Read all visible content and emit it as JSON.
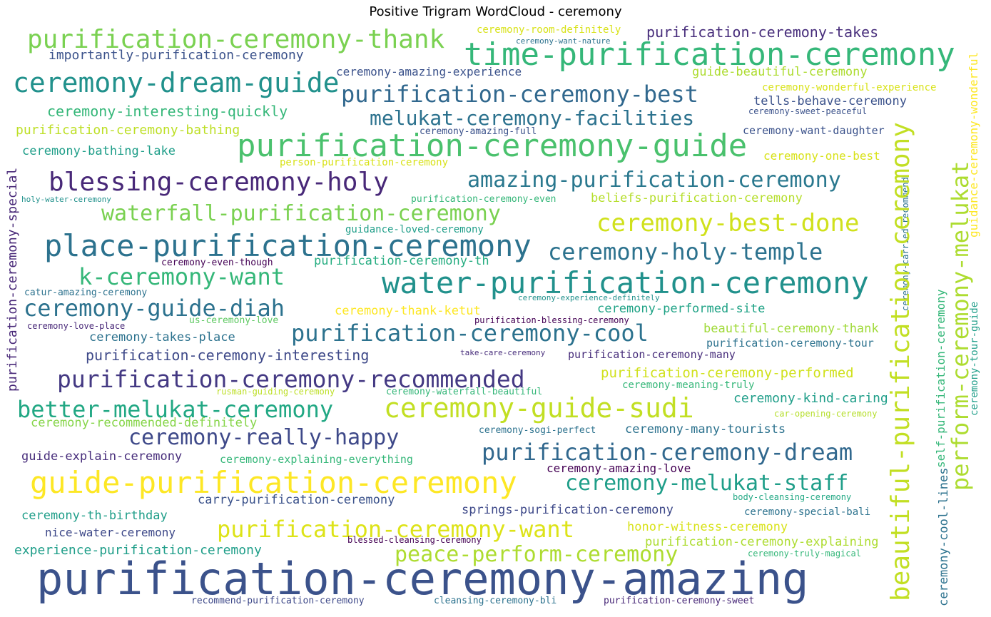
{
  "chart_data": {
    "type": "wordcloud",
    "title": "Positive Trigram WordCloud - ceremony",
    "words": [
      {
        "text": "purification-ceremony-thank",
        "color": "#7ad151"
      },
      {
        "text": "ceremony-room-definitely",
        "color": "#d8e219"
      },
      {
        "text": "ceremony-want-nature",
        "color": "#2c728e"
      },
      {
        "text": "purification-ceremony-takes",
        "color": "#472d7b"
      },
      {
        "text": "importantly-purification-ceremony",
        "color": "#3b528b"
      },
      {
        "text": "time-purification-ceremony",
        "color": "#35b779"
      },
      {
        "text": "ceremony-amazing-experience",
        "color": "#3b528b"
      },
      {
        "text": "guide-beautiful-ceremony",
        "color": "#addc30"
      },
      {
        "text": "ceremony-dream-guide",
        "color": "#21918c"
      },
      {
        "text": "ceremony-wonderful-experience",
        "color": "#d8e219"
      },
      {
        "text": "purification-ceremony-best",
        "color": "#31688e"
      },
      {
        "text": "tells-behave-ceremony",
        "color": "#3b528b"
      },
      {
        "text": "ceremony-interesting-quickly",
        "color": "#35b779"
      },
      {
        "text": "melukat-ceremony-facilities",
        "color": "#2c728e"
      },
      {
        "text": "ceremony-sweet-peaceful",
        "color": "#3b528b"
      },
      {
        "text": "purification-ceremony-bathing",
        "color": "#bddf26"
      },
      {
        "text": "ceremony-amazing-full",
        "color": "#3b528b"
      },
      {
        "text": "ceremony-want-daughter",
        "color": "#3b528b"
      },
      {
        "text": "ceremony-bathing-lake",
        "color": "#1f9e89"
      },
      {
        "text": "purification-ceremony-guide",
        "color": "#4ac16d"
      },
      {
        "text": "ceremony-one-best",
        "color": "#d8e219"
      },
      {
        "text": "person-purification-ceremony",
        "color": "#d8e219"
      },
      {
        "text": "blessing-ceremony-holy",
        "color": "#482878"
      },
      {
        "text": "amazing-purification-ceremony",
        "color": "#2a788e"
      },
      {
        "text": "holy-water-ceremony",
        "color": "#21918c"
      },
      {
        "text": "purification-ceremony-even",
        "color": "#35b779"
      },
      {
        "text": "beliefs-purification-ceremony",
        "color": "#b5de2b"
      },
      {
        "text": "waterfall-purification-ceremony",
        "color": "#7ad151"
      },
      {
        "text": "ceremony-best-done",
        "color": "#d0e11c"
      },
      {
        "text": "guidance-loved-ceremony",
        "color": "#1f9e89"
      },
      {
        "text": "place-purification-ceremony",
        "color": "#2c728e"
      },
      {
        "text": "ceremony-holy-temple",
        "color": "#2c728e"
      },
      {
        "text": "ceremony-even-though",
        "color": "#440154"
      },
      {
        "text": "purification-ceremony-th",
        "color": "#26ad81"
      },
      {
        "text": "k-ceremony-want",
        "color": "#35b779"
      },
      {
        "text": "water-purification-ceremony",
        "color": "#21918c"
      },
      {
        "text": "catur-amazing-ceremony",
        "color": "#2c728e"
      },
      {
        "text": "ceremony-experience-definitely",
        "color": "#21918c"
      },
      {
        "text": "ceremony-guide-diah",
        "color": "#2c728e"
      },
      {
        "text": "ceremony-thank-ketut",
        "color": "#fde725"
      },
      {
        "text": "ceremony-performed-site",
        "color": "#20a386"
      },
      {
        "text": "ceremony-love-place",
        "color": "#482878"
      },
      {
        "text": "us-ceremony-love",
        "color": "#5ec962"
      },
      {
        "text": "purification-blessing-ceremony",
        "color": "#440154"
      },
      {
        "text": "purification-ceremony-cool",
        "color": "#2c728e"
      },
      {
        "text": "beautiful-ceremony-thank",
        "color": "#a0da39"
      },
      {
        "text": "ceremony-takes-place",
        "color": "#2c728e"
      },
      {
        "text": "purification-ceremony-tour",
        "color": "#2c728e"
      },
      {
        "text": "purification-ceremony-interesting",
        "color": "#3e4989"
      },
      {
        "text": "take-care-ceremony",
        "color": "#472d7b"
      },
      {
        "text": "purification-ceremony-many",
        "color": "#472d7b"
      },
      {
        "text": "purification-ceremony-recommended",
        "color": "#443983"
      },
      {
        "text": "purification-ceremony-performed",
        "color": "#d0e11c"
      },
      {
        "text": "rusman-guiding-ceremony",
        "color": "#bddf26"
      },
      {
        "text": "ceremony-waterfall-beautiful",
        "color": "#35b779"
      },
      {
        "text": "ceremony-meaning-truly",
        "color": "#35b779"
      },
      {
        "text": "better-melukat-ceremony",
        "color": "#22a884"
      },
      {
        "text": "ceremony-guide-sudi",
        "color": "#c2df23"
      },
      {
        "text": "ceremony-kind-caring",
        "color": "#1f9e89"
      },
      {
        "text": "ceremony-recommended-definitely",
        "color": "#86d549"
      },
      {
        "text": "car-opening-ceremony",
        "color": "#b5de2b"
      },
      {
        "text": "ceremony-really-happy",
        "color": "#3e4989"
      },
      {
        "text": "ceremony-sogi-perfect",
        "color": "#2c728e"
      },
      {
        "text": "ceremony-many-tourists",
        "color": "#2c728e"
      },
      {
        "text": "guide-explain-ceremony",
        "color": "#472d7b"
      },
      {
        "text": "ceremony-explaining-everything",
        "color": "#35b779"
      },
      {
        "text": "purification-ceremony-dream",
        "color": "#31688e"
      },
      {
        "text": "ceremony-amazing-love",
        "color": "#440154"
      },
      {
        "text": "guide-purification-ceremony",
        "color": "#fde725"
      },
      {
        "text": "ceremony-melukat-staff",
        "color": "#1f9e89"
      },
      {
        "text": "carry-purification-ceremony",
        "color": "#3b528b"
      },
      {
        "text": "body-cleansing-ceremony",
        "color": "#22a884"
      },
      {
        "text": "springs-purification-ceremony",
        "color": "#3e4989"
      },
      {
        "text": "ceremony-special-bali",
        "color": "#2c728e"
      },
      {
        "text": "ceremony-th-birthday",
        "color": "#1f9e89"
      },
      {
        "text": "nice-water-ceremony",
        "color": "#3e4989"
      },
      {
        "text": "purification-ceremony-want",
        "color": "#dde318"
      },
      {
        "text": "honor-witness-ceremony",
        "color": "#d8e219"
      },
      {
        "text": "experience-purification-ceremony",
        "color": "#1f9e89"
      },
      {
        "text": "blessed-cleansing-ceremony",
        "color": "#440154"
      },
      {
        "text": "peace-perform-ceremony",
        "color": "#addc30"
      },
      {
        "text": "purification-ceremony-explaining",
        "color": "#addc30"
      },
      {
        "text": "ceremony-truly-magical",
        "color": "#35b779"
      },
      {
        "text": "purification-ceremony-amazing",
        "color": "#3b528b"
      },
      {
        "text": "recommend-purification-ceremony",
        "color": "#3e4989"
      },
      {
        "text": "cleansing-ceremony-bli",
        "color": "#2c728e"
      },
      {
        "text": "purification-ceremony-sweet",
        "color": "#482878"
      },
      {
        "text": "purification-ceremony-special",
        "color": "#482878"
      },
      {
        "text": "ceremony-carried-recommend",
        "color": "#2c728e"
      },
      {
        "text": "self-purification-ceremony",
        "color": "#35b779"
      },
      {
        "text": "ceremony-cool-lines",
        "color": "#2c728e"
      },
      {
        "text": "beautiful-purification-ceremony",
        "color": "#c2df23"
      },
      {
        "text": "perform-ceremony-melukat",
        "color": "#addc30"
      },
      {
        "text": "guidance-ceremony-wonderful",
        "color": "#fde725"
      },
      {
        "text": "ceremony-tour-guide",
        "color": "#1f9e89"
      }
    ]
  }
}
